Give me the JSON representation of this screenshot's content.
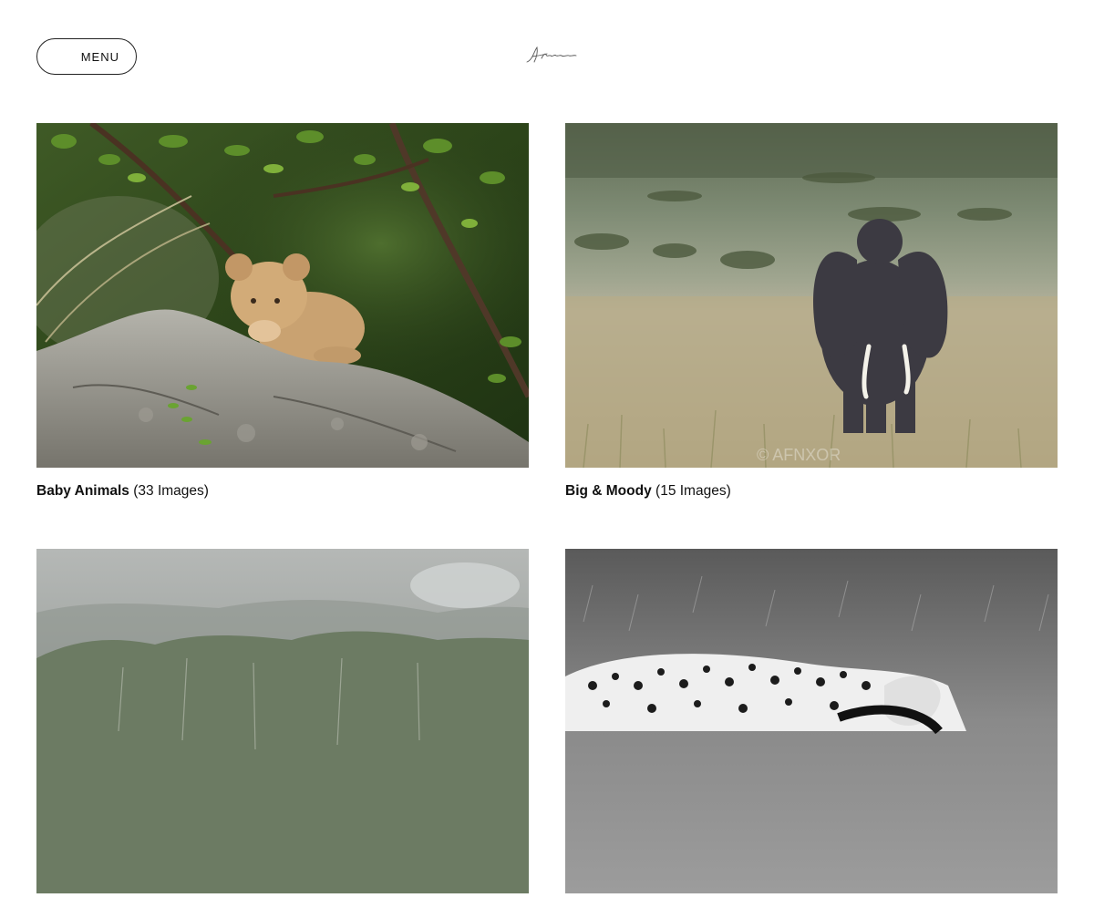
{
  "header": {
    "menu_label": "MENU",
    "logo_icon": "signature-logo-icon"
  },
  "galleries": [
    {
      "title": "Baby Animals",
      "count": "(33 Images)",
      "image": "lion-cub-photo"
    },
    {
      "title": "Big & Moody",
      "count": "(15 Images)",
      "image": "elephant-photo"
    },
    {
      "title": "",
      "count": "",
      "image": "misty-forest-photo"
    },
    {
      "title": "",
      "count": "",
      "image": "cheetah-bw-photo"
    }
  ],
  "watermark": "© AFNXOR"
}
